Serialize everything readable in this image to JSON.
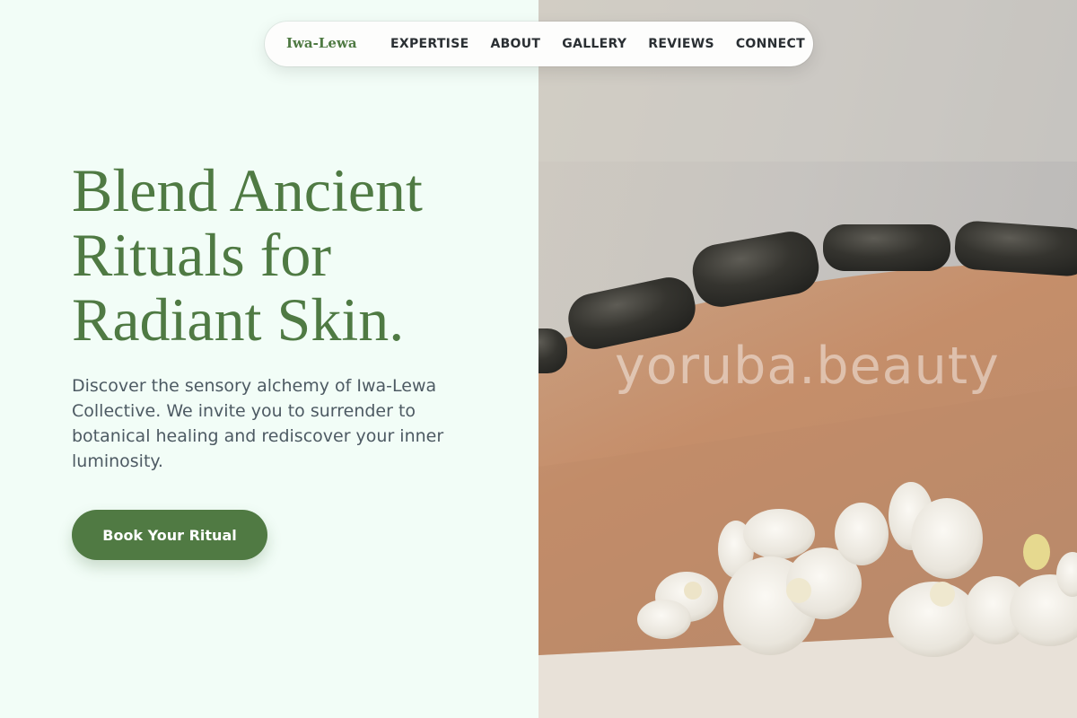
{
  "nav": {
    "brand": "Iwa-Lewa",
    "links": [
      "EXPERTISE",
      "ABOUT",
      "GALLERY",
      "REVIEWS",
      "CONNECT"
    ]
  },
  "hero": {
    "headline_lines": [
      "Blend Ancient",
      "Rituals for",
      "Radiant Skin."
    ],
    "description": "Discover the sensory alchemy of Iwa-Lewa Collective. We invite you to surrender to botanical healing and rediscover your inner luminosity.",
    "cta_label": "Book Your Ritual"
  },
  "image": {
    "watermark": "yoruba.beauty"
  },
  "colors": {
    "accent": "#507a43",
    "background": "#f2fdf7",
    "body_text": "#4d5a63"
  }
}
